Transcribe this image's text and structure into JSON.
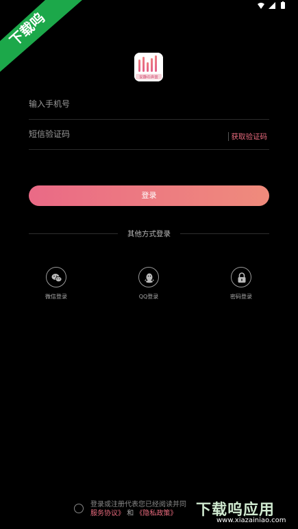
{
  "status_bar": {
    "icons": [
      "signal-icon",
      "wifi-icon",
      "battery-icon"
    ]
  },
  "corner_badge": {
    "text": "下载呜"
  },
  "logo": {
    "text": "安静の声音"
  },
  "form": {
    "phone_placeholder": "输入手机号",
    "code_placeholder": "短信验证码",
    "get_code_label": "获取验证码"
  },
  "login_button_label": "登录",
  "other_methods_label": "其他方式登录",
  "login_options": [
    {
      "label": "微信登录",
      "icon": "wechat-icon"
    },
    {
      "label": "QQ登录",
      "icon": "qq-icon"
    },
    {
      "label": "密码登录",
      "icon": "lock-icon"
    }
  ],
  "agreement": {
    "text": "登录或注册代表您已经阅读并同",
    "service_link": "服务协议》",
    "and_text": "和",
    "privacy_link": "《隐私政策》"
  },
  "watermark": {
    "big": "下载呜应用",
    "url": "www.xiazainiao.com"
  },
  "colors": {
    "background": "#000000",
    "accent": "#ea6b7e",
    "button_gradient_start": "#ea6a86",
    "button_gradient_end": "#ef8b7c",
    "ribbon": "#1ca84a"
  }
}
